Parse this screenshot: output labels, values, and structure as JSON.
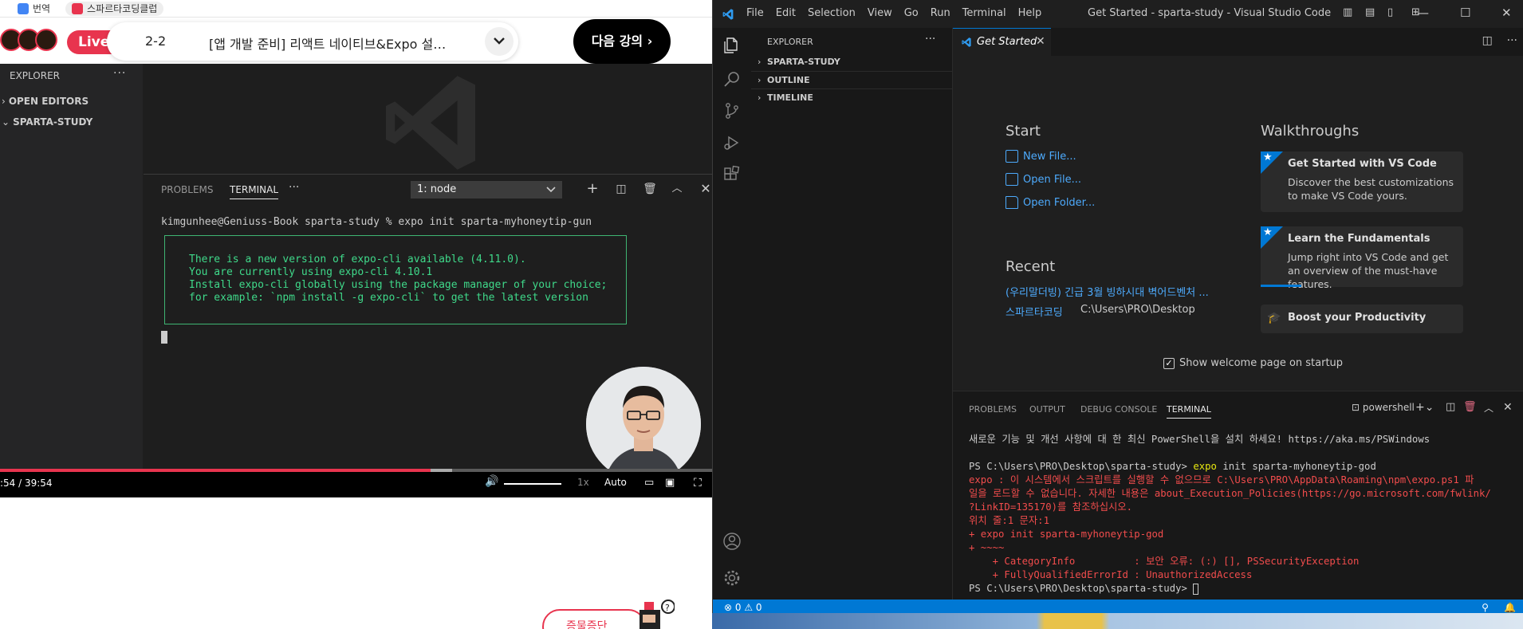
{
  "browser": {
    "bookmarks": [
      {
        "label": "번역",
        "color": "#4285f4"
      },
      {
        "label": "스파르타코딩클럽",
        "color": "#e8344e"
      }
    ],
    "live_label": "Live",
    "lecture": {
      "number": "2-2",
      "title": "[앱 개발 준비] 리액트 네이티브&Expo 설…"
    },
    "next_button": "다음 강의 ›",
    "report_button": "증물증단"
  },
  "video": {
    "explorer_header": "EXPLORER",
    "open_editors": "OPEN EDITORS",
    "workspace": "SPARTA-STUDY",
    "panel_tabs": [
      "PROBLEMS",
      "TERMINAL"
    ],
    "terminal_select": "1: node",
    "prompt": "kimgunhee@Geniuss-Book sparta-study % expo init sparta-myhoneytip-gun",
    "box_lines": [
      "There is a new version of expo-cli available (4.11.0).",
      "You are currently using expo-cli 4.10.1",
      "Install expo-cli globally using the package manager of your choice;",
      "for example: `npm install -g expo-cli` to get the latest version"
    ],
    "time": ":54 /   39:54",
    "progress_played": 0.605,
    "progress_buffered": 0.635,
    "speed": "1x",
    "quality": "Auto"
  },
  "vscode": {
    "menu": [
      "File",
      "Edit",
      "Selection",
      "View",
      "Go",
      "Run",
      "Terminal",
      "Help"
    ],
    "window_title": "Get Started - sparta-study - Visual Studio Code",
    "sidebar": {
      "header": "EXPLORER",
      "sections": [
        "SPARTA-STUDY",
        "OUTLINE",
        "TIMELINE"
      ]
    },
    "tab": "Get Started",
    "welcome": {
      "start_heading": "Start",
      "start_links": [
        "New File...",
        "Open File...",
        "Open Folder..."
      ],
      "recent_heading": "Recent",
      "recent": [
        {
          "name": "(우리말더빙) 긴급 3월 빙하시대 벽어드벤처 ...",
          "path": ""
        },
        {
          "name": "스파르타코딩",
          "path": "C:\\Users\\PRO\\Desktop"
        }
      ],
      "walkthroughs_heading": "Walkthroughs",
      "walkthroughs": [
        {
          "title": "Get Started with VS Code",
          "desc": "Discover the best customizations to make VS Code yours.",
          "progress": 0
        },
        {
          "title": "Learn the Fundamentals",
          "desc": "Jump right into VS Code and get an overview of the must-have features.",
          "progress": 0.2
        },
        {
          "title": "Boost your Productivity",
          "desc": "",
          "progress": 0
        }
      ],
      "startup_checkbox": "Show welcome page on startup"
    },
    "panel": {
      "tabs": [
        "PROBLEMS",
        "OUTPUT",
        "DEBUG CONSOLE",
        "TERMINAL"
      ],
      "shell": "powershell",
      "lines": [
        {
          "text": "새로운 기능 및 개선 사항에 대 한 최신 PowerShell을 설치 하세요! https://aka.ms/PSWindows",
          "cls": ""
        },
        {
          "text": "",
          "cls": ""
        },
        {
          "text": "PS C:\\Users\\PRO\\Desktop\\sparta-study> ",
          "cls": "",
          "cmd": "expo init sparta-myhoneytip-god"
        },
        {
          "text": "expo : 이 시스템에서 스크립트를 실행할 수 없으므로 C:\\Users\\PRO\\AppData\\Roaming\\npm\\expo.ps1 파",
          "cls": "err"
        },
        {
          "text": "일을 로드할 수 없습니다. 자세한 내용은 about_Execution_Policies(https://go.microsoft.com/fwlink/",
          "cls": "err"
        },
        {
          "text": "?LinkID=135170)를 참조하십시오.",
          "cls": "err"
        },
        {
          "text": "위치 줄:1 문자:1",
          "cls": "err"
        },
        {
          "text": "+ expo init sparta-myhoneytip-god",
          "cls": "err"
        },
        {
          "text": "+ ~~~~",
          "cls": "err"
        },
        {
          "text": "    + CategoryInfo          : 보안 오류: (:) [], PSSecurityException",
          "cls": "err"
        },
        {
          "text": "    + FullyQualifiedErrorId : UnauthorizedAccess",
          "cls": "err"
        },
        {
          "text": "PS C:\\Users\\PRO\\Desktop\\sparta-study> ",
          "cls": "",
          "cursor": true
        }
      ]
    },
    "status": {
      "problems": "⊗ 0 ⚠ 0"
    }
  }
}
